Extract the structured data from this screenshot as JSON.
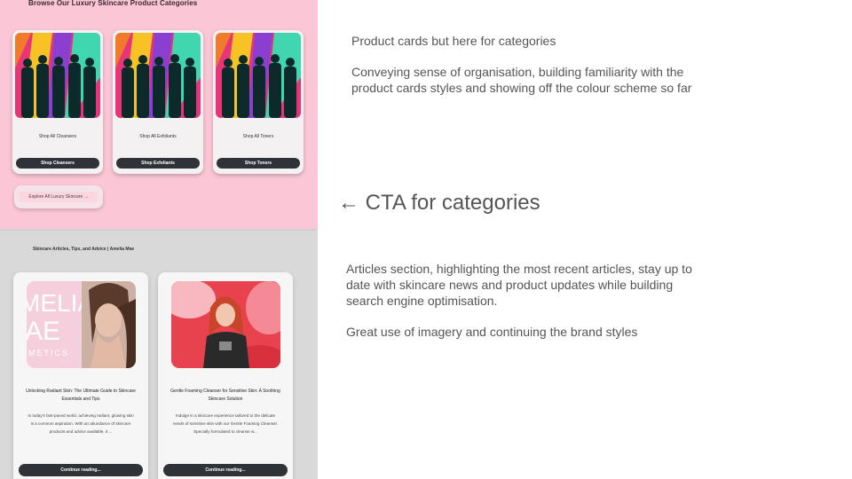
{
  "categories": {
    "title": "Browse Our Luxury Skincare Product Categories",
    "cards": [
      {
        "label": "Shop All Cleansers",
        "button": "Shop Cleansers"
      },
      {
        "label": "Shop All Exfoliants",
        "button": "Shop Exfoliants"
      },
      {
        "label": "Shop All Toners",
        "button": "Shop Toners"
      }
    ],
    "explore_button": "Explore All Luxury Skincare →"
  },
  "articles": {
    "title": "Skincare Articles, Tips, and Advice | Amelia Mae",
    "cards": [
      {
        "heading": "Unlocking Radiant Skin: The Ultimate Guide to Skincare Essentials and Tips",
        "excerpt": "In today's fast-paced world, achieving radiant, glowing skin is a common aspiration. With an abundance of skincare products and advice available, it ...",
        "button": "Continue reading...",
        "image_text": [
          "MELIA",
          "AE",
          "SMETICS"
        ]
      },
      {
        "heading": "Gentle Foaming Cleanser for Sensitive Skin: A Soothing Skincare Solution",
        "excerpt": "Indulge in a skincare experience tailored to the delicate needs of sensitive skin with our Gentle Foaming Cleanser. Specially formulated to cleanse w...",
        "button": "Continue reading..."
      }
    ]
  },
  "annotations": {
    "categories_note": [
      "Product cards but here for categories",
      "Conveying sense of organisation, building familiarity with the product cards styles and showing off the colour scheme so far"
    ],
    "cta_note": "← CTA for categories",
    "articles_note": [
      "Articles section, highlighting the most recent articles, stay up to date with skincare news and product updates while building search engine optimisation.",
      "Great use of imagery and continuing the brand styles"
    ]
  },
  "colors": {
    "categories_bg": "#fbc6d6",
    "articles_bg": "#d9d9d9",
    "button_dark": "#2f3338",
    "annotation_text": "#555555"
  }
}
